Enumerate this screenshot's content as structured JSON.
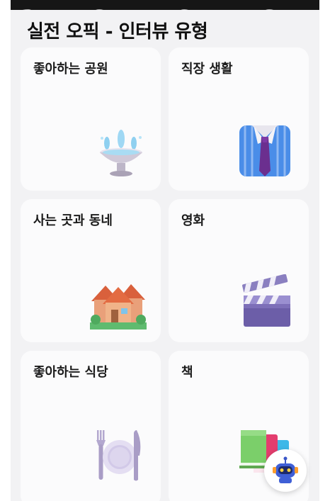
{
  "header": {
    "title": "실전 오픽 - 인터뷰 유형"
  },
  "topics": [
    {
      "label": "좋아하는 공원",
      "icon": "fountain-icon"
    },
    {
      "label": "직장 생활",
      "icon": "shirt-tie-icon"
    },
    {
      "label": "사는 곳과 동네",
      "icon": "houses-icon"
    },
    {
      "label": "영화",
      "icon": "clapperboard-icon"
    },
    {
      "label": "좋아하는 식당",
      "icon": "fork-knife-plate-icon"
    },
    {
      "label": "책",
      "icon": "books-icon"
    }
  ],
  "assistant_button": {
    "icon": "robot-icon"
  },
  "colors": {
    "background": "#f2f2f4",
    "card": "#fbfbfc",
    "title_text": "#111111"
  }
}
